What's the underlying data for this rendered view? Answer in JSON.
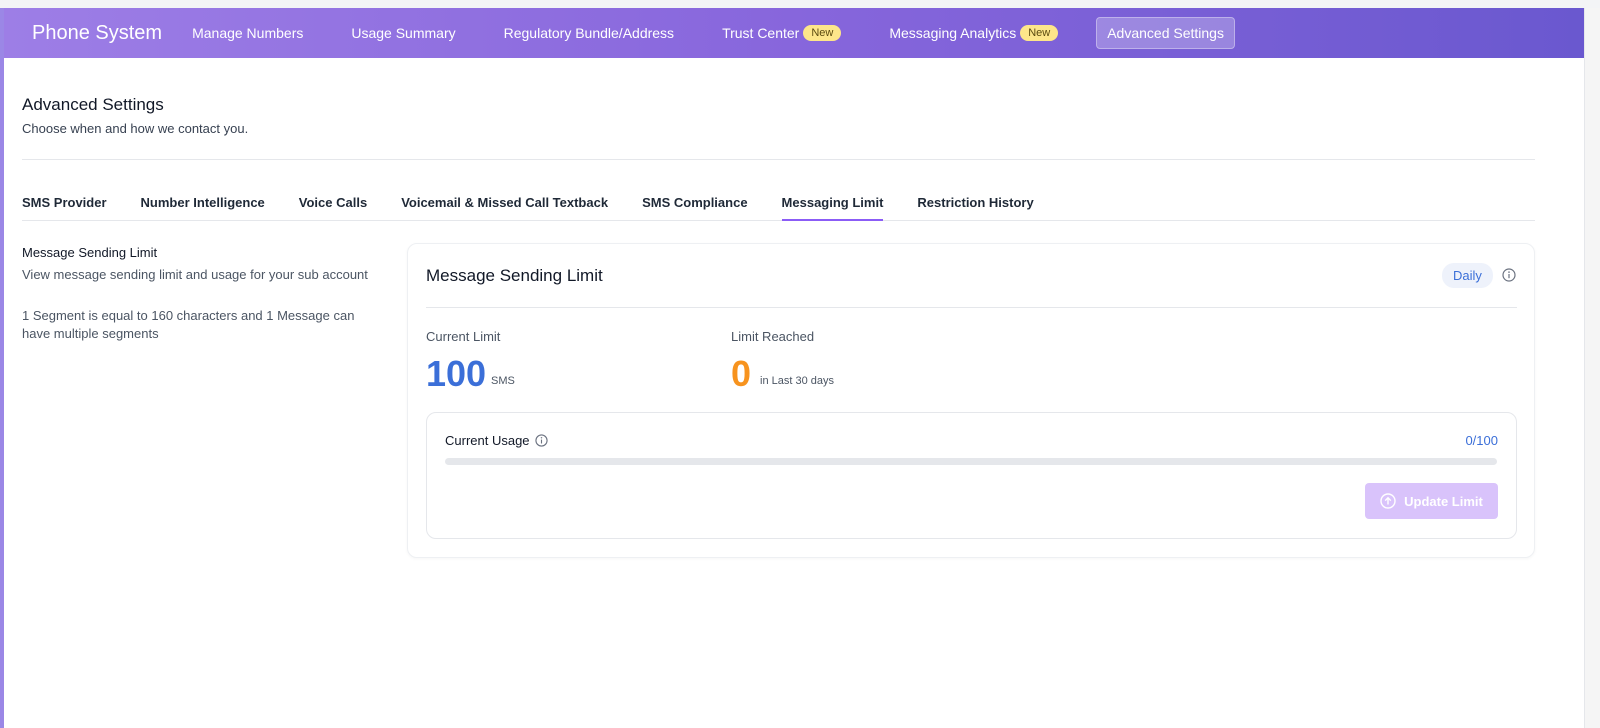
{
  "topnav": {
    "brand": "Phone System",
    "items": [
      {
        "label": "Manage Numbers"
      },
      {
        "label": "Usage Summary"
      },
      {
        "label": "Regulatory Bundle/Address"
      },
      {
        "label": "Trust Center",
        "badge": "New"
      },
      {
        "label": "Messaging Analytics",
        "badge": "New"
      },
      {
        "label": "Advanced Settings",
        "active": true
      }
    ]
  },
  "page": {
    "title": "Advanced Settings",
    "subtitle": "Choose when and how we contact you."
  },
  "tabs": [
    {
      "label": "SMS Provider"
    },
    {
      "label": "Number Intelligence"
    },
    {
      "label": "Voice Calls"
    },
    {
      "label": "Voicemail & Missed Call Textback"
    },
    {
      "label": "SMS Compliance"
    },
    {
      "label": "Messaging Limit",
      "active": true
    },
    {
      "label": "Restriction History"
    }
  ],
  "sidebar": {
    "title": "Message Sending Limit",
    "desc1": "View message sending limit and usage for your sub account",
    "desc2": "1 Segment is equal to 160 characters and 1 Message can have multiple segments"
  },
  "card": {
    "title": "Message Sending Limit",
    "period": "Daily",
    "current_limit_label": "Current Limit",
    "current_limit_value": "100",
    "current_limit_unit": "SMS",
    "limit_reached_label": "Limit Reached",
    "limit_reached_value": "0",
    "limit_reached_unit": "in Last 30 days",
    "usage_label": "Current Usage",
    "usage_count": "0/100",
    "usage_fraction": 0,
    "update_button": "Update Limit"
  },
  "colors": {
    "accent_blue": "#3b6fd8",
    "accent_orange": "#f7931e",
    "accent_purple": "#8b5cf6",
    "badge_yellow": "#fde68a"
  },
  "icons": {
    "info": "info-circle-icon",
    "upload": "arrow-up-circle-icon"
  }
}
